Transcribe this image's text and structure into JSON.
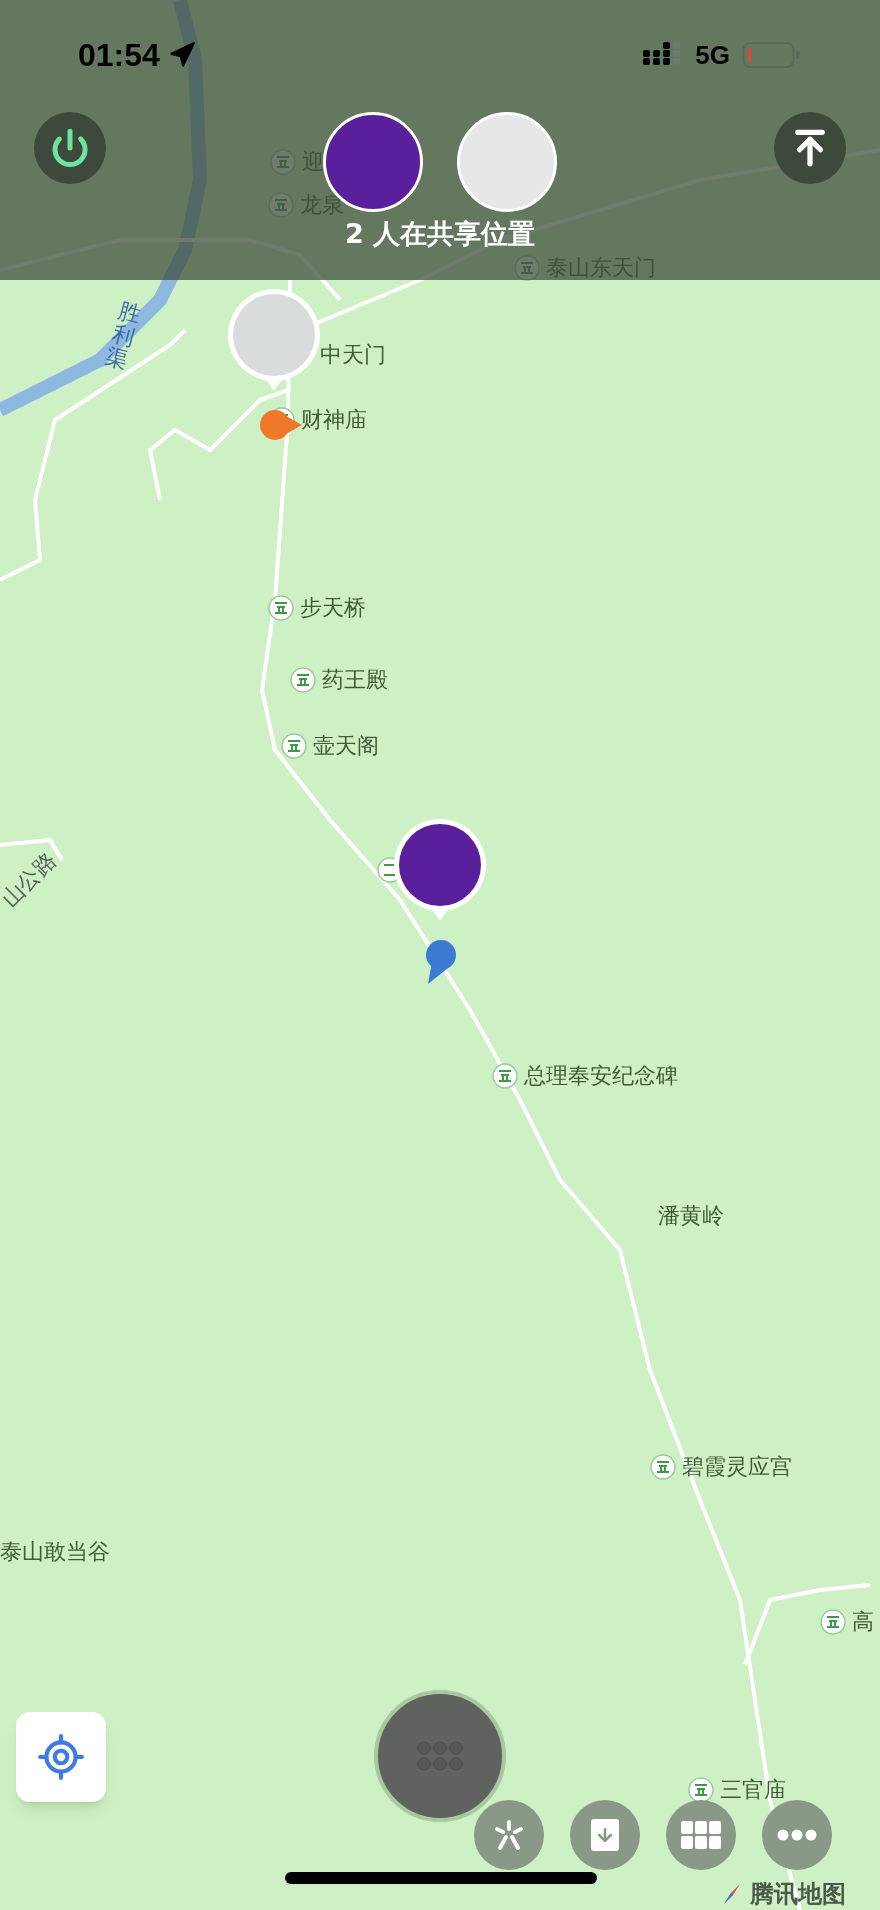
{
  "status_bar": {
    "time": "01:54",
    "network": "5G"
  },
  "sharing": {
    "label": "2 人在共享位置"
  },
  "map": {
    "labels": [
      {
        "kind": "poi",
        "text": "迎"
      },
      {
        "kind": "poi",
        "text": "龙泉"
      },
      {
        "kind": "poi",
        "text": "泰山东天门"
      },
      {
        "kind": "river",
        "text": "胜利渠"
      },
      {
        "kind": "place",
        "text": "中天门"
      },
      {
        "kind": "poi",
        "text": "财神庙"
      },
      {
        "kind": "poi",
        "text": "步天桥"
      },
      {
        "kind": "poi",
        "text": "药王殿"
      },
      {
        "kind": "poi",
        "text": "壶天阁"
      },
      {
        "kind": "road",
        "text": "山公路"
      },
      {
        "kind": "poi",
        "text": "总理奉安纪念碑"
      },
      {
        "kind": "place",
        "text": "潘黄岭"
      },
      {
        "kind": "poi",
        "text": "碧霞灵应宫"
      },
      {
        "kind": "place",
        "text": "泰山敢当谷"
      },
      {
        "kind": "poi",
        "text": "高"
      },
      {
        "kind": "poi",
        "text": "三官庙"
      }
    ]
  },
  "attribution": {
    "text": "腾讯地图"
  }
}
